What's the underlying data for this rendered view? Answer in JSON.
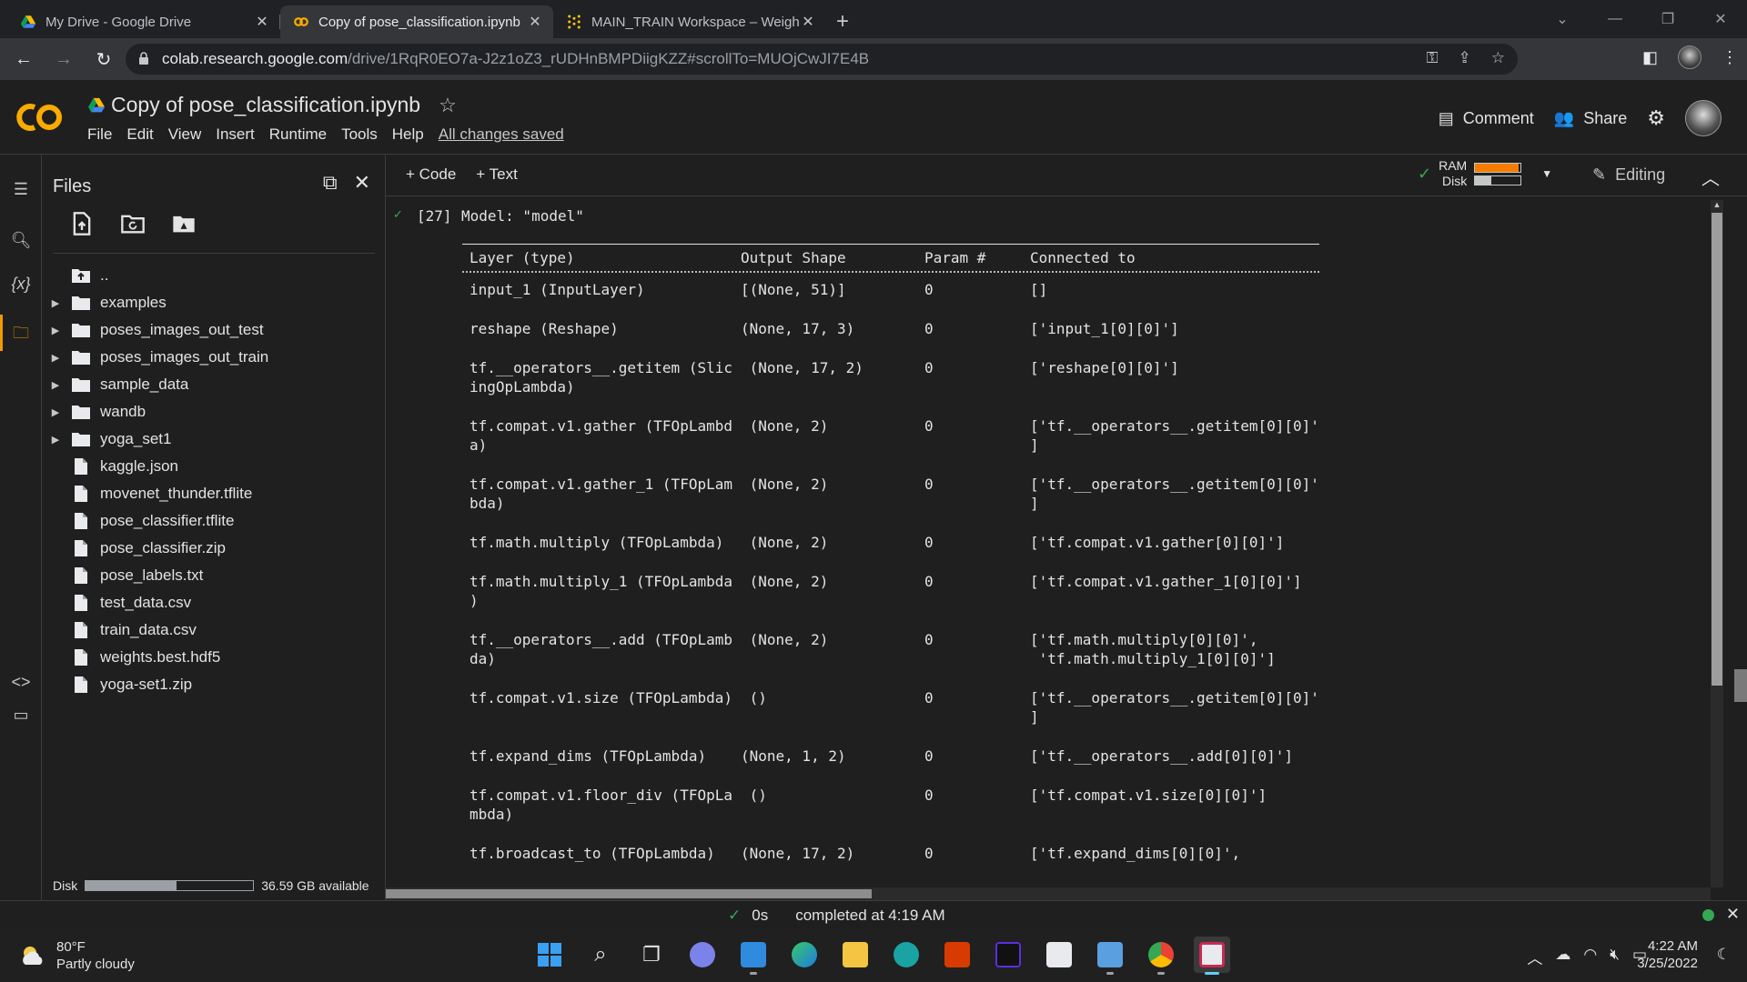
{
  "browser": {
    "tabs": [
      {
        "title": "My Drive - Google Drive",
        "icon": "google-drive-icon",
        "active": false
      },
      {
        "title": "Copy of pose_classification.ipynb",
        "icon": "colab-icon",
        "active": true
      },
      {
        "title": "MAIN_TRAIN Workspace – Weigh",
        "icon": "wandb-icon",
        "active": false
      }
    ],
    "url_host": "colab.research.google.com",
    "url_path": "/drive/1RqR0EO7a-J2z1oZ3_rUDHnBMPDiigKZZ#scrollTo=MUOjCwJI7E4B"
  },
  "colab": {
    "notebook_title": "Copy of pose_classification.ipynb",
    "menu": [
      "File",
      "Edit",
      "View",
      "Insert",
      "Runtime",
      "Tools",
      "Help"
    ],
    "save_status": "All changes saved",
    "comment_label": "Comment",
    "share_label": "Share"
  },
  "files_panel": {
    "title": "Files",
    "items": [
      {
        "name": "..",
        "type": "parent"
      },
      {
        "name": "examples",
        "type": "folder"
      },
      {
        "name": "poses_images_out_test",
        "type": "folder"
      },
      {
        "name": "poses_images_out_train",
        "type": "folder"
      },
      {
        "name": "sample_data",
        "type": "folder"
      },
      {
        "name": "wandb",
        "type": "folder"
      },
      {
        "name": "yoga_set1",
        "type": "folder"
      },
      {
        "name": "kaggle.json",
        "type": "file"
      },
      {
        "name": "movenet_thunder.tflite",
        "type": "file"
      },
      {
        "name": "pose_classifier.tflite",
        "type": "file"
      },
      {
        "name": "pose_classifier.zip",
        "type": "file"
      },
      {
        "name": "pose_labels.txt",
        "type": "file"
      },
      {
        "name": "test_data.csv",
        "type": "file"
      },
      {
        "name": "train_data.csv",
        "type": "file"
      },
      {
        "name": "weights.best.hdf5",
        "type": "file"
      },
      {
        "name": "yoga-set1.zip",
        "type": "file"
      }
    ],
    "disk_label": "Disk",
    "disk_available": "36.59 GB available",
    "disk_used_fraction": 0.54
  },
  "toolbar": {
    "add_code": "+ Code",
    "add_text": "+ Text",
    "ram_label": "RAM",
    "disk_label": "Disk",
    "ram_fraction": 0.95,
    "disk_fraction": 0.35,
    "editing_label": "Editing"
  },
  "cell": {
    "exec_count": "[27]",
    "model_line": "Model: \"model\"",
    "headers": [
      "Layer (type)",
      "Output Shape",
      "Param #",
      "Connected to"
    ],
    "rows": [
      {
        "layer": "input_1 (InputLayer)",
        "shape": "[(None, 51)]",
        "params": "0",
        "connected": "[]"
      },
      {
        "layer": "reshape (Reshape)",
        "shape": "(None, 17, 3)",
        "params": "0",
        "connected": "['input_1[0][0]']"
      },
      {
        "layer": "tf.__operators__.getitem (Slic\ningOpLambda)",
        "shape": " (None, 17, 2)",
        "params": "0",
        "connected": "['reshape[0][0]']"
      },
      {
        "layer": "tf.compat.v1.gather (TFOpLambd\na)",
        "shape": " (None, 2)",
        "params": "0",
        "connected": "['tf.__operators__.getitem[0][0]'\n]"
      },
      {
        "layer": "tf.compat.v1.gather_1 (TFOpLam\nbda)",
        "shape": " (None, 2)",
        "params": "0",
        "connected": "['tf.__operators__.getitem[0][0]'\n]"
      },
      {
        "layer": "tf.math.multiply (TFOpLambda)",
        "shape": " (None, 2)",
        "params": "0",
        "connected": "['tf.compat.v1.gather[0][0]']"
      },
      {
        "layer": "tf.math.multiply_1 (TFOpLambda\n)",
        "shape": " (None, 2)",
        "params": "0",
        "connected": "['tf.compat.v1.gather_1[0][0]']"
      },
      {
        "layer": "tf.__operators__.add (TFOpLamb\nda)",
        "shape": " (None, 2)",
        "params": "0",
        "connected": "['tf.math.multiply[0][0]',\n 'tf.math.multiply_1[0][0]']"
      },
      {
        "layer": "tf.compat.v1.size (TFOpLambda)",
        "shape": " ()",
        "params": "0",
        "connected": "['tf.__operators__.getitem[0][0]'\n]"
      },
      {
        "layer": "tf.expand_dims (TFOpLambda)",
        "shape": "(None, 1, 2)",
        "params": "0",
        "connected": "['tf.__operators__.add[0][0]']"
      },
      {
        "layer": "tf.compat.v1.floor_div (TFOpLa\nmbda)",
        "shape": " ()",
        "params": "0",
        "connected": "['tf.compat.v1.size[0][0]']"
      },
      {
        "layer": "tf.broadcast_to (TFOpLambda)",
        "shape": "(None, 17, 2)",
        "params": "0",
        "connected": "['tf.expand_dims[0][0]',"
      }
    ]
  },
  "statusbar": {
    "duration": "0s",
    "completed": "completed at 4:19 AM"
  },
  "taskbar": {
    "temperature": "80°F",
    "condition": "Partly cloudy",
    "time": "4:22 AM",
    "date": "3/25/2022",
    "apps": [
      "start-icon",
      "search-icon",
      "task-view-icon",
      "teams-chat-icon",
      "mail-icon",
      "edge-icon",
      "file-explorer-icon",
      "app-e-icon",
      "office-icon",
      "jetbrains-icon",
      "document-editor-icon",
      "photos-icon",
      "chrome-icon",
      "snipping-tool-icon"
    ]
  }
}
